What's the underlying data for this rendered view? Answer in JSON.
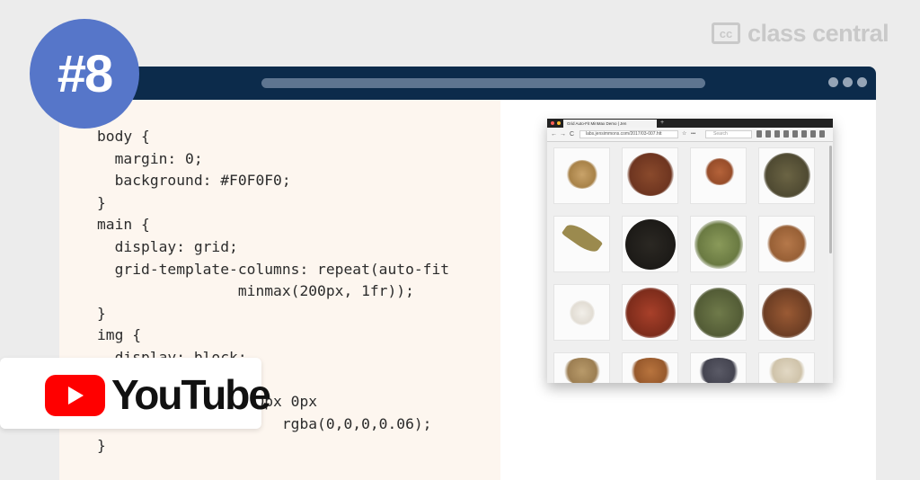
{
  "brand": {
    "mark": "cc",
    "name": "class central"
  },
  "badge": {
    "rank": "#8"
  },
  "youtube": {
    "label": "YouTube",
    "icon": "youtube-play-icon"
  },
  "code": {
    "lines": [
      "body {",
      "  margin: 0;",
      "  background: #F0F0F0;",
      "}",
      "main {",
      "  display: grid;",
      "  grid-template-columns: repeat(auto-fit",
      "                minmax(200px, 1fr));",
      "}",
      "img {",
      "  display: block;",
      "",
      "  box-shadow: 2px 0px 0px",
      "                     rgba(0,0,0,0.06);",
      "}"
    ]
  },
  "inner_browser": {
    "tab_title": "Grid Auto-Fit MinMax Demo | Jen",
    "new_tab": "+",
    "url": "labs.jensimmons.com/2017/03-007.htt",
    "search_placeholder": "Search",
    "nav": {
      "back": "←",
      "forward": "→",
      "reload": "C",
      "home": "ⓘ",
      "bookmark": "☆",
      "menu": "•••"
    }
  },
  "colors": {
    "badge": "#5676c9",
    "titlebar": "#0c2b4b",
    "code_bg": "#fdf6ef",
    "youtube_red": "#ff0000"
  }
}
